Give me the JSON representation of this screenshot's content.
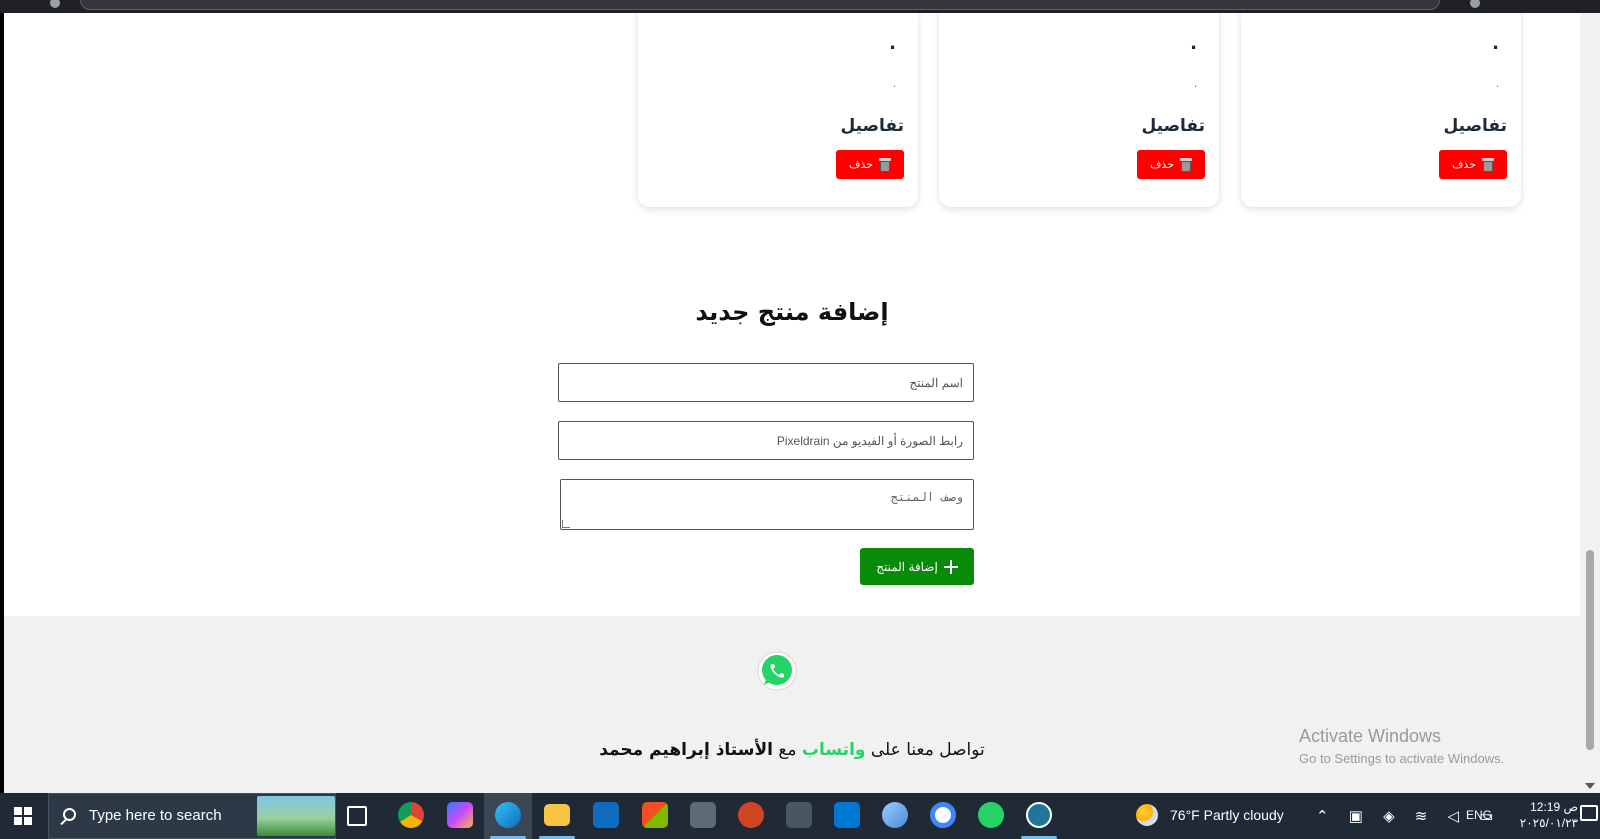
{
  "cards": [
    {
      "dot_title": ".",
      "dot_desc": ".",
      "details_label": "تفاصيل",
      "delete_label": "حذف"
    },
    {
      "dot_title": ".",
      "dot_desc": ".",
      "details_label": "تفاصيل",
      "delete_label": "حذف"
    },
    {
      "dot_title": ".",
      "dot_desc": ".",
      "details_label": "تفاصيل",
      "delete_label": "حذف"
    }
  ],
  "add_product": {
    "title": "إضافة منتج جديد",
    "name_placeholder": "اسم المنتج",
    "link_placeholder": "رابط الصورة أو الفيديو من Pixeldrain",
    "desc_placeholder": "وصف المنتج",
    "submit_label": "إضافة المنتج"
  },
  "footer": {
    "text_part1": "تواصل معنا على",
    "text_whatsapp": "واتساب",
    "text_part2": "مع",
    "text_name": "الأستاذ إبراهيم محمد",
    "whatsapp_color": "#25d366"
  },
  "watermark": {
    "line1": "Activate Windows",
    "line2": "Go to Settings to activate Windows."
  },
  "taskbar": {
    "search_text": "Type here to search",
    "weather": "76°F  Partly cloudy",
    "language": "ENG",
    "time": "12:19 ص",
    "date": "٢٠٢٥/٠١/٢٣"
  },
  "colors": {
    "delete_button": "#ff0000",
    "add_button": "#0a8a0a",
    "footer_bg": "#f1f1f1"
  }
}
